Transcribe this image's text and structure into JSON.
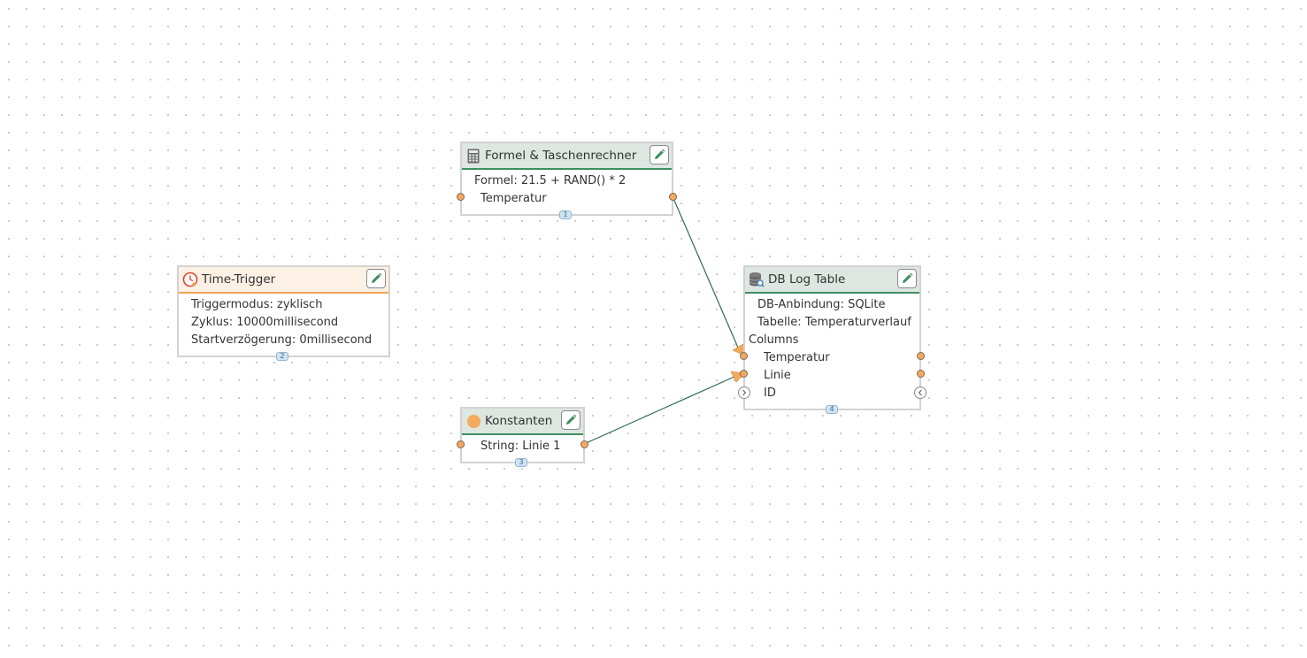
{
  "nodes": {
    "formel": {
      "title": "Formel & Taschenrechner",
      "icon": "calculator-icon",
      "formula_line": "Formel: 21.5 + RAND() * 2",
      "output_label": "Temperatur",
      "badge": "1"
    },
    "time_trigger": {
      "title": "Time-Trigger",
      "icon": "clock-icon",
      "triggermodus": "Triggermodus: zyklisch",
      "zyklus": "Zyklus: 10000millisecond",
      "startverzoegerung": "Startverzögerung: 0millisecond",
      "badge": "2"
    },
    "konstanten": {
      "title": "Konstanten",
      "icon": "constant-circle-icon",
      "string_value": "String: Linie 1",
      "badge": "3"
    },
    "db_log": {
      "title": "DB Log Table",
      "icon": "database-icon",
      "anbindung": "DB-Anbindung: SQLite",
      "tabelle": "Tabelle: Temperaturverlauf",
      "columns_label": "Columns",
      "columns": [
        "Temperatur",
        "Linie",
        "ID"
      ],
      "badge": "4"
    }
  },
  "colors": {
    "header_green": "#dde6e1",
    "header_green_border": "#3f8f5f",
    "header_orange": "#fdf0e4",
    "header_orange_border": "#f0a556",
    "port": "#f4a95c",
    "link": "#2f6b50",
    "arrow": "#f4a95c"
  },
  "icons": {
    "edit": "pencil-icon",
    "port_in": "chevron-right-icon",
    "port_out": "chevron-left-icon"
  },
  "links": [
    {
      "from": "formel.Temperatur",
      "to": "db_log.Temperatur"
    },
    {
      "from": "konstanten.String",
      "to": "db_log.Linie"
    }
  ]
}
